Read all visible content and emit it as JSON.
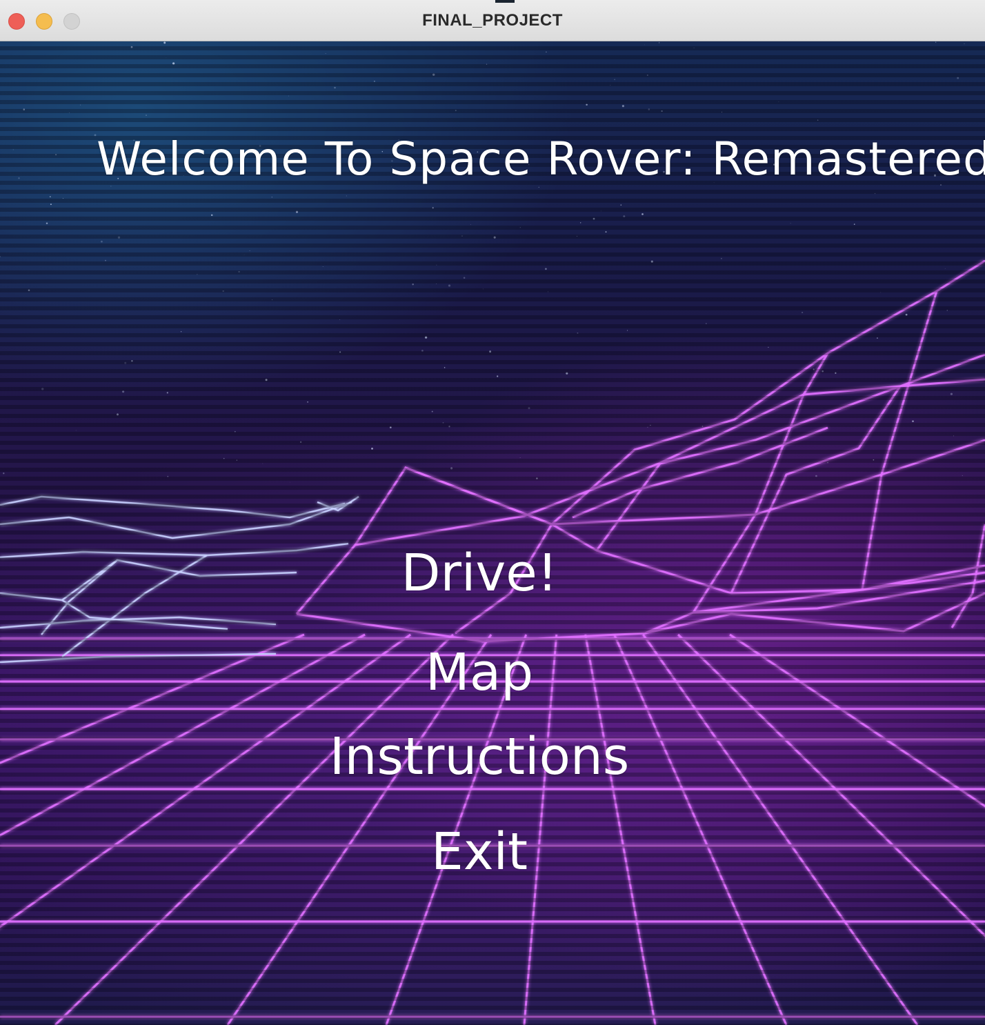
{
  "window": {
    "title": "FINAL_PROJECT"
  },
  "game": {
    "title": "Welcome To Space Rover: Remastered",
    "menu": {
      "drive": "Drive!",
      "map": "Map",
      "instructions": "Instructions",
      "exit": "Exit"
    }
  },
  "colors": {
    "grid_line": "#e070ff",
    "grid_line_left": "#c8d0ff",
    "text": "#ffffff"
  }
}
